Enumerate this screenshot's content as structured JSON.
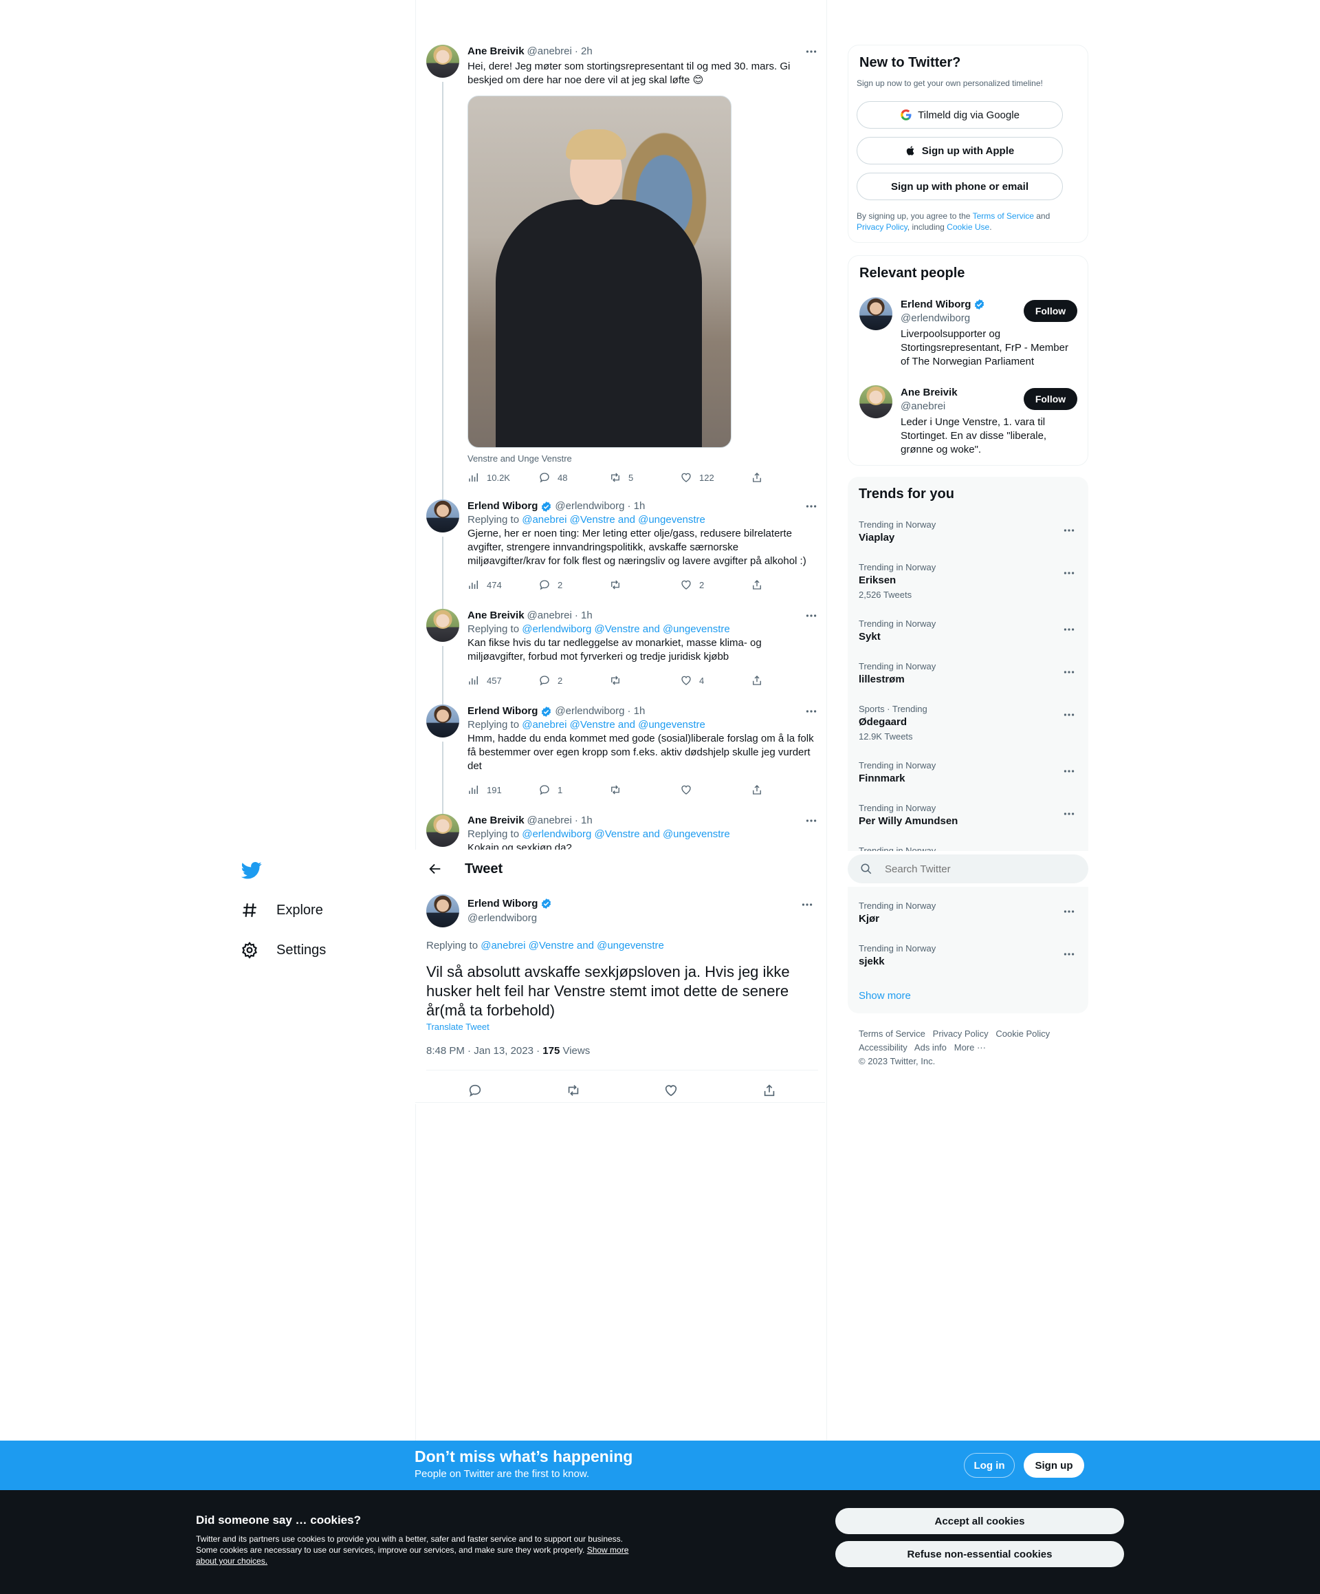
{
  "nav": {
    "explore": "Explore",
    "settings": "Settings"
  },
  "thread": [
    {
      "name": "Ane Breivik",
      "handle": "@anebrei",
      "time": "· 2h",
      "text": "Hei, dere! Jeg møter som stortingsrepresentant til og med 30. mars. Gi beskjed om dere har noe dere vil at jeg skal løfte 😊",
      "photo_caption": "Venstre and Unge Venstre",
      "views": "10.2K",
      "replies": "48",
      "retweets": "5",
      "likes": "122"
    },
    {
      "name": "Erlend Wiborg",
      "handle": "@erlendwiborg",
      "time": "· 1h",
      "replying_prefix": "Replying to ",
      "replying_to": "@anebrei @Venstre and @ungevenstre",
      "text": "Gjerne, her er noen ting: Mer leting etter olje/gass, redusere bilrelaterte avgifter, strengere innvandringspolitikk, avskaffe særnorske miljøavgifter/krav for folk flest og næringsliv og lavere avgifter på alkohol :)",
      "views": "474",
      "replies": "2",
      "retweets": "",
      "likes": "2"
    },
    {
      "name": "Ane Breivik",
      "handle": "@anebrei",
      "time": "· 1h",
      "replying_prefix": "Replying to ",
      "replying_to": "@erlendwiborg @Venstre and @ungevenstre",
      "text": "Kan fikse hvis du tar nedleggelse av monarkiet, masse klima- og miljøavgifter, forbud mot fyrverkeri og tredje juridisk kjøbb",
      "views": "457",
      "replies": "2",
      "retweets": "",
      "likes": "4"
    },
    {
      "name": "Erlend Wiborg",
      "handle": "@erlendwiborg",
      "time": "· 1h",
      "replying_prefix": "Replying to ",
      "replying_to": "@anebrei @Venstre and @ungevenstre",
      "text": "Hmm, hadde du enda kommet med gode (sosial)liberale forslag om å la folk få bestemmer over egen kropp som f.eks. aktiv dødshjelp skulle jeg vurdert det",
      "views": "191",
      "replies": "1",
      "retweets": "",
      "likes": ""
    },
    {
      "name": "Ane Breivik",
      "handle": "@anebrei",
      "time": "· 1h",
      "replying_prefix": "Replying to ",
      "replying_to": "@erlendwiborg @Venstre and @ungevenstre",
      "text": "Kokain og sexkjøp da?"
    }
  ],
  "main_header": {
    "title": "Tweet"
  },
  "main_tweet": {
    "name": "Erlend Wiborg",
    "handle": "@erlendwiborg",
    "replying_prefix": "Replying to ",
    "replying_to": "@anebrei @Venstre and @ungevenstre",
    "text": "Vil så absolutt avskaffe sexkjøpsloven ja. Hvis jeg ikke husker helt feil har Venstre stemt imot dette de senere år(må ta forbehold)",
    "translate": "Translate Tweet",
    "timestamp": "8:48 PM · Jan 13, 2023 · ",
    "views_count": "175",
    "views_label": " Views"
  },
  "new_to_twitter": {
    "title": "New to Twitter?",
    "subtitle": "Sign up now to get your own personalized timeline!",
    "google": "Tilmeld dig via Google",
    "apple": "Sign up with Apple",
    "phone": "Sign up with phone or email",
    "legal_1": "By signing up, you agree to the ",
    "terms": "Terms of Service",
    "legal_2": " and",
    "privacy": "Privacy Policy",
    "legal_3": ", including ",
    "cookie": "Cookie Use",
    "legal_4": "."
  },
  "relevant_people": {
    "title": "Relevant people",
    "people": [
      {
        "name": "Erlend Wiborg",
        "handle": "@erlendwiborg",
        "bio": "Liverpoolsupporter og Stortingsrepresentant, FrP - Member of The Norwegian Parliament",
        "follow": "Follow"
      },
      {
        "name": "Ane Breivik",
        "handle": "@anebrei",
        "bio": "Leder i Unge Venstre, 1. vara til Stortinget. En av disse \"liberale, grønne og woke\".",
        "follow": "Follow"
      }
    ]
  },
  "trends": {
    "title": "Trends for you",
    "items": [
      {
        "category": "Trending in Norway",
        "name": "Viaplay",
        "count": ""
      },
      {
        "category": "Trending in Norway",
        "name": "Eriksen",
        "count": "2,526 Tweets"
      },
      {
        "category": "Trending in Norway",
        "name": "Sykt",
        "count": ""
      },
      {
        "category": "Trending in Norway",
        "name": "lillestrøm",
        "count": ""
      },
      {
        "category": "Sports · Trending",
        "name": "Ødegaard",
        "count": "12.9K Tweets"
      },
      {
        "category": "Trending in Norway",
        "name": "Finnmark",
        "count": ""
      },
      {
        "category": "Trending in Norway",
        "name": "Per Willy Amundsen",
        "count": ""
      },
      {
        "category": "Trending in Norway",
        "name": "Kjør",
        "count": ""
      },
      {
        "category": "Trending in Norway",
        "name": "sjekk",
        "count": ""
      }
    ],
    "partial_category": "Trending in Norway",
    "show_more": "Show more"
  },
  "search": {
    "placeholder": "Search Twitter"
  },
  "footer": {
    "terms": "Terms of Service",
    "privacy": "Privacy Policy",
    "cookie": "Cookie Policy",
    "accessibility": "Accessibility",
    "ads": "Ads info",
    "more": "More ···",
    "copyright": "© 2023 Twitter, Inc."
  },
  "signup_bar": {
    "title": "Don’t miss what’s happening",
    "subtitle": "People on Twitter are the first to know.",
    "login": "Log in",
    "signup": "Sign up"
  },
  "cookies": {
    "title": "Did someone say … cookies?",
    "text": "Twitter and its partners use cookies to provide you with a better, safer and faster service and to support our business. Some cookies are necessary to use our services, improve our services, and make sure they work properly. ",
    "link": "Show more about your choices.",
    "accept": "Accept all cookies",
    "refuse": "Refuse non-essential cookies"
  },
  "colors": {
    "accent": "#1d9bf0",
    "text": "#0f1419",
    "muted": "#536471",
    "cookie_bg": "#0f1419"
  }
}
